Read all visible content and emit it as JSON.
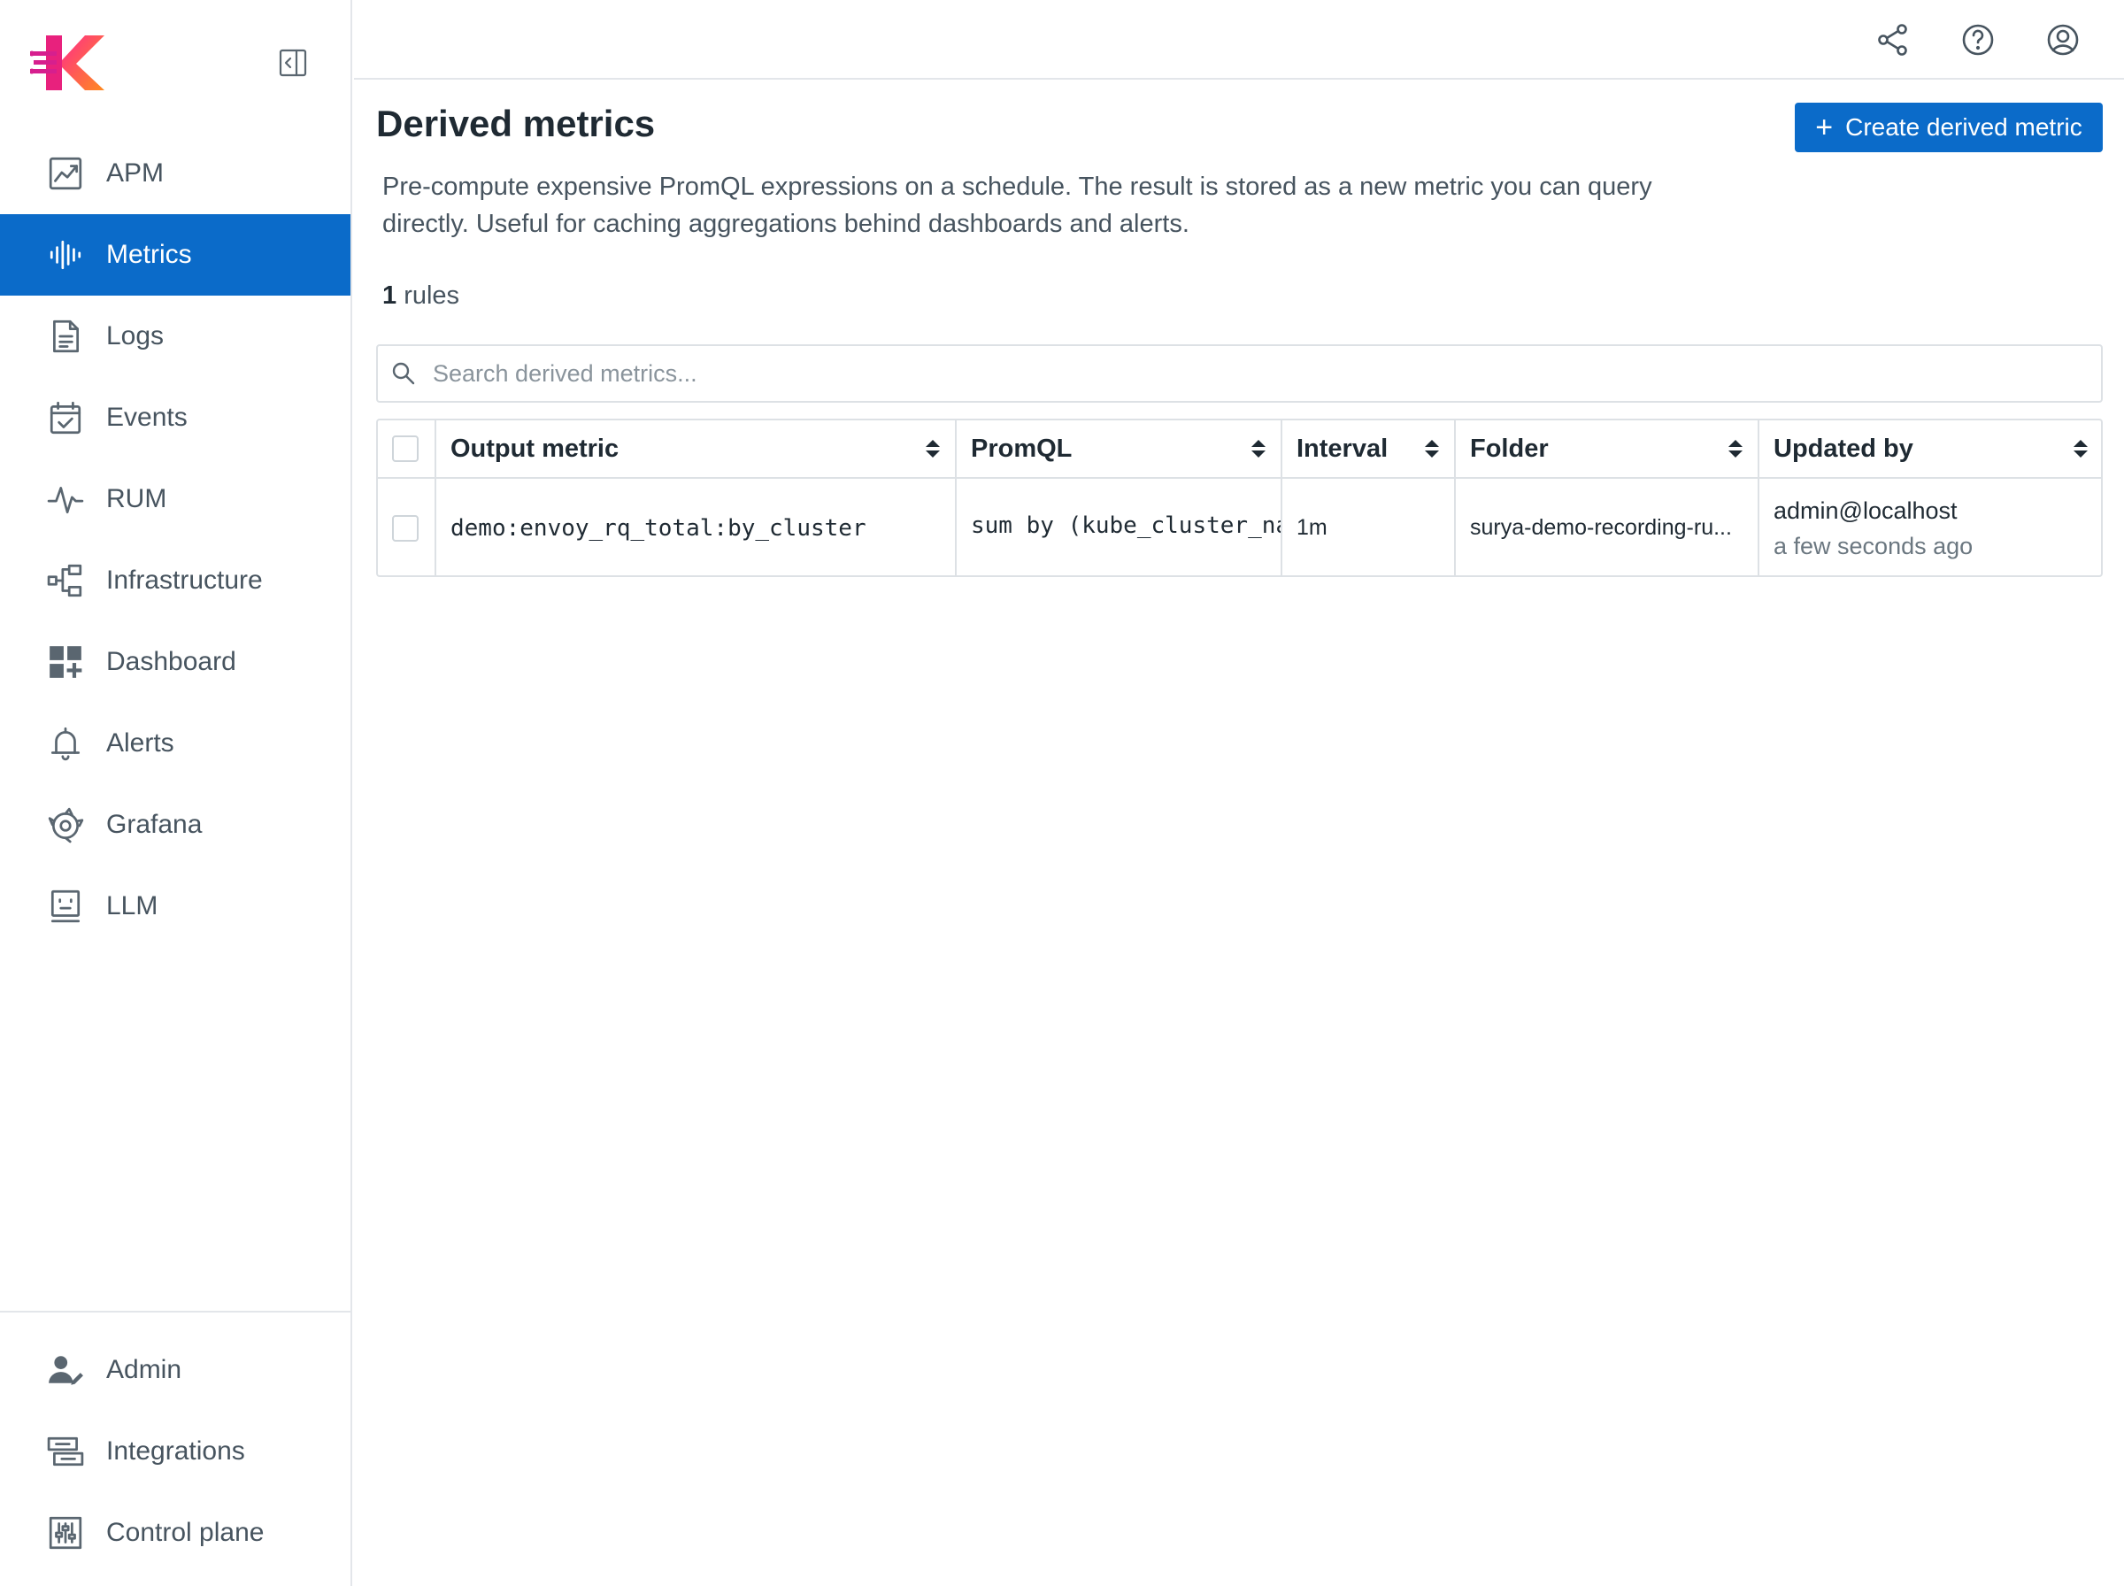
{
  "app": {
    "name": "Kloudmate"
  },
  "sidebar": {
    "items": [
      {
        "label": "APM",
        "icon": "apm-chart-icon"
      },
      {
        "label": "Metrics",
        "icon": "metrics-waveform-icon",
        "active": true
      },
      {
        "label": "Logs",
        "icon": "logs-document-icon"
      },
      {
        "label": "Events",
        "icon": "events-calendar-icon"
      },
      {
        "label": "RUM",
        "icon": "rum-pulse-icon"
      },
      {
        "label": "Infrastructure",
        "icon": "infrastructure-nodes-icon"
      },
      {
        "label": "Dashboard",
        "icon": "dashboard-grid-icon"
      },
      {
        "label": "Alerts",
        "icon": "alerts-bell-icon"
      },
      {
        "label": "Grafana",
        "icon": "grafana-icon"
      },
      {
        "label": "LLM",
        "icon": "llm-robot-icon"
      }
    ],
    "bottom_items": [
      {
        "label": "Admin",
        "icon": "admin-user-icon"
      },
      {
        "label": "Integrations",
        "icon": "integrations-icon"
      },
      {
        "label": "Control plane",
        "icon": "control-plane-icon"
      }
    ]
  },
  "header": {
    "title": "Derived metrics",
    "create_button": "Create derived metric",
    "description": "Pre-compute expensive PromQL expressions on a schedule. The result is stored as a new metric you can query directly. Useful for caching aggregations behind dashboards and alerts.",
    "count": "1",
    "count_suffix": " rules"
  },
  "search": {
    "placeholder": "Search derived metrics..."
  },
  "table": {
    "columns": [
      "Output metric",
      "PromQL",
      "Interval",
      "Folder",
      "Updated by"
    ],
    "rows": [
      {
        "output_metric": "demo:envoy_rq_total:by_cluster",
        "promql": "sum by (kube_cluster_name",
        "interval": "1m",
        "folder": "surya-demo-recording-ru...",
        "updated_by": "admin@localhost",
        "updated_at": "a few seconds ago"
      }
    ]
  },
  "colors": {
    "accent": "#0b6bc9",
    "border": "#dde1e5",
    "text": "#1f2a33",
    "muted": "#47545f"
  }
}
